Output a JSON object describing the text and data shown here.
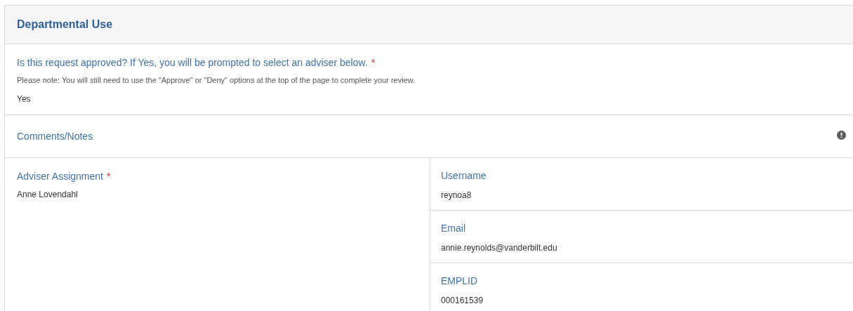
{
  "panel": {
    "title": "Departmental Use"
  },
  "question": {
    "label": "Is this request approved? If Yes, you will be prompted to select an adviser below.",
    "required_mark": "*",
    "note": "Please note: You will still need to use the \"Approve\" or \"Deny\" options at the top of the page to complete your review.",
    "value": "Yes"
  },
  "comments": {
    "label": "Comments/Notes"
  },
  "adviser": {
    "label": "Adviser Assignment",
    "required_mark": "*",
    "value": "Anne Lovendahl"
  },
  "details": [
    {
      "label": "Username",
      "value": "reynoa8"
    },
    {
      "label": "Email",
      "value": "annie.reynolds@vanderbilt.edu"
    },
    {
      "label": "EMPLID",
      "value": "000161539"
    }
  ]
}
